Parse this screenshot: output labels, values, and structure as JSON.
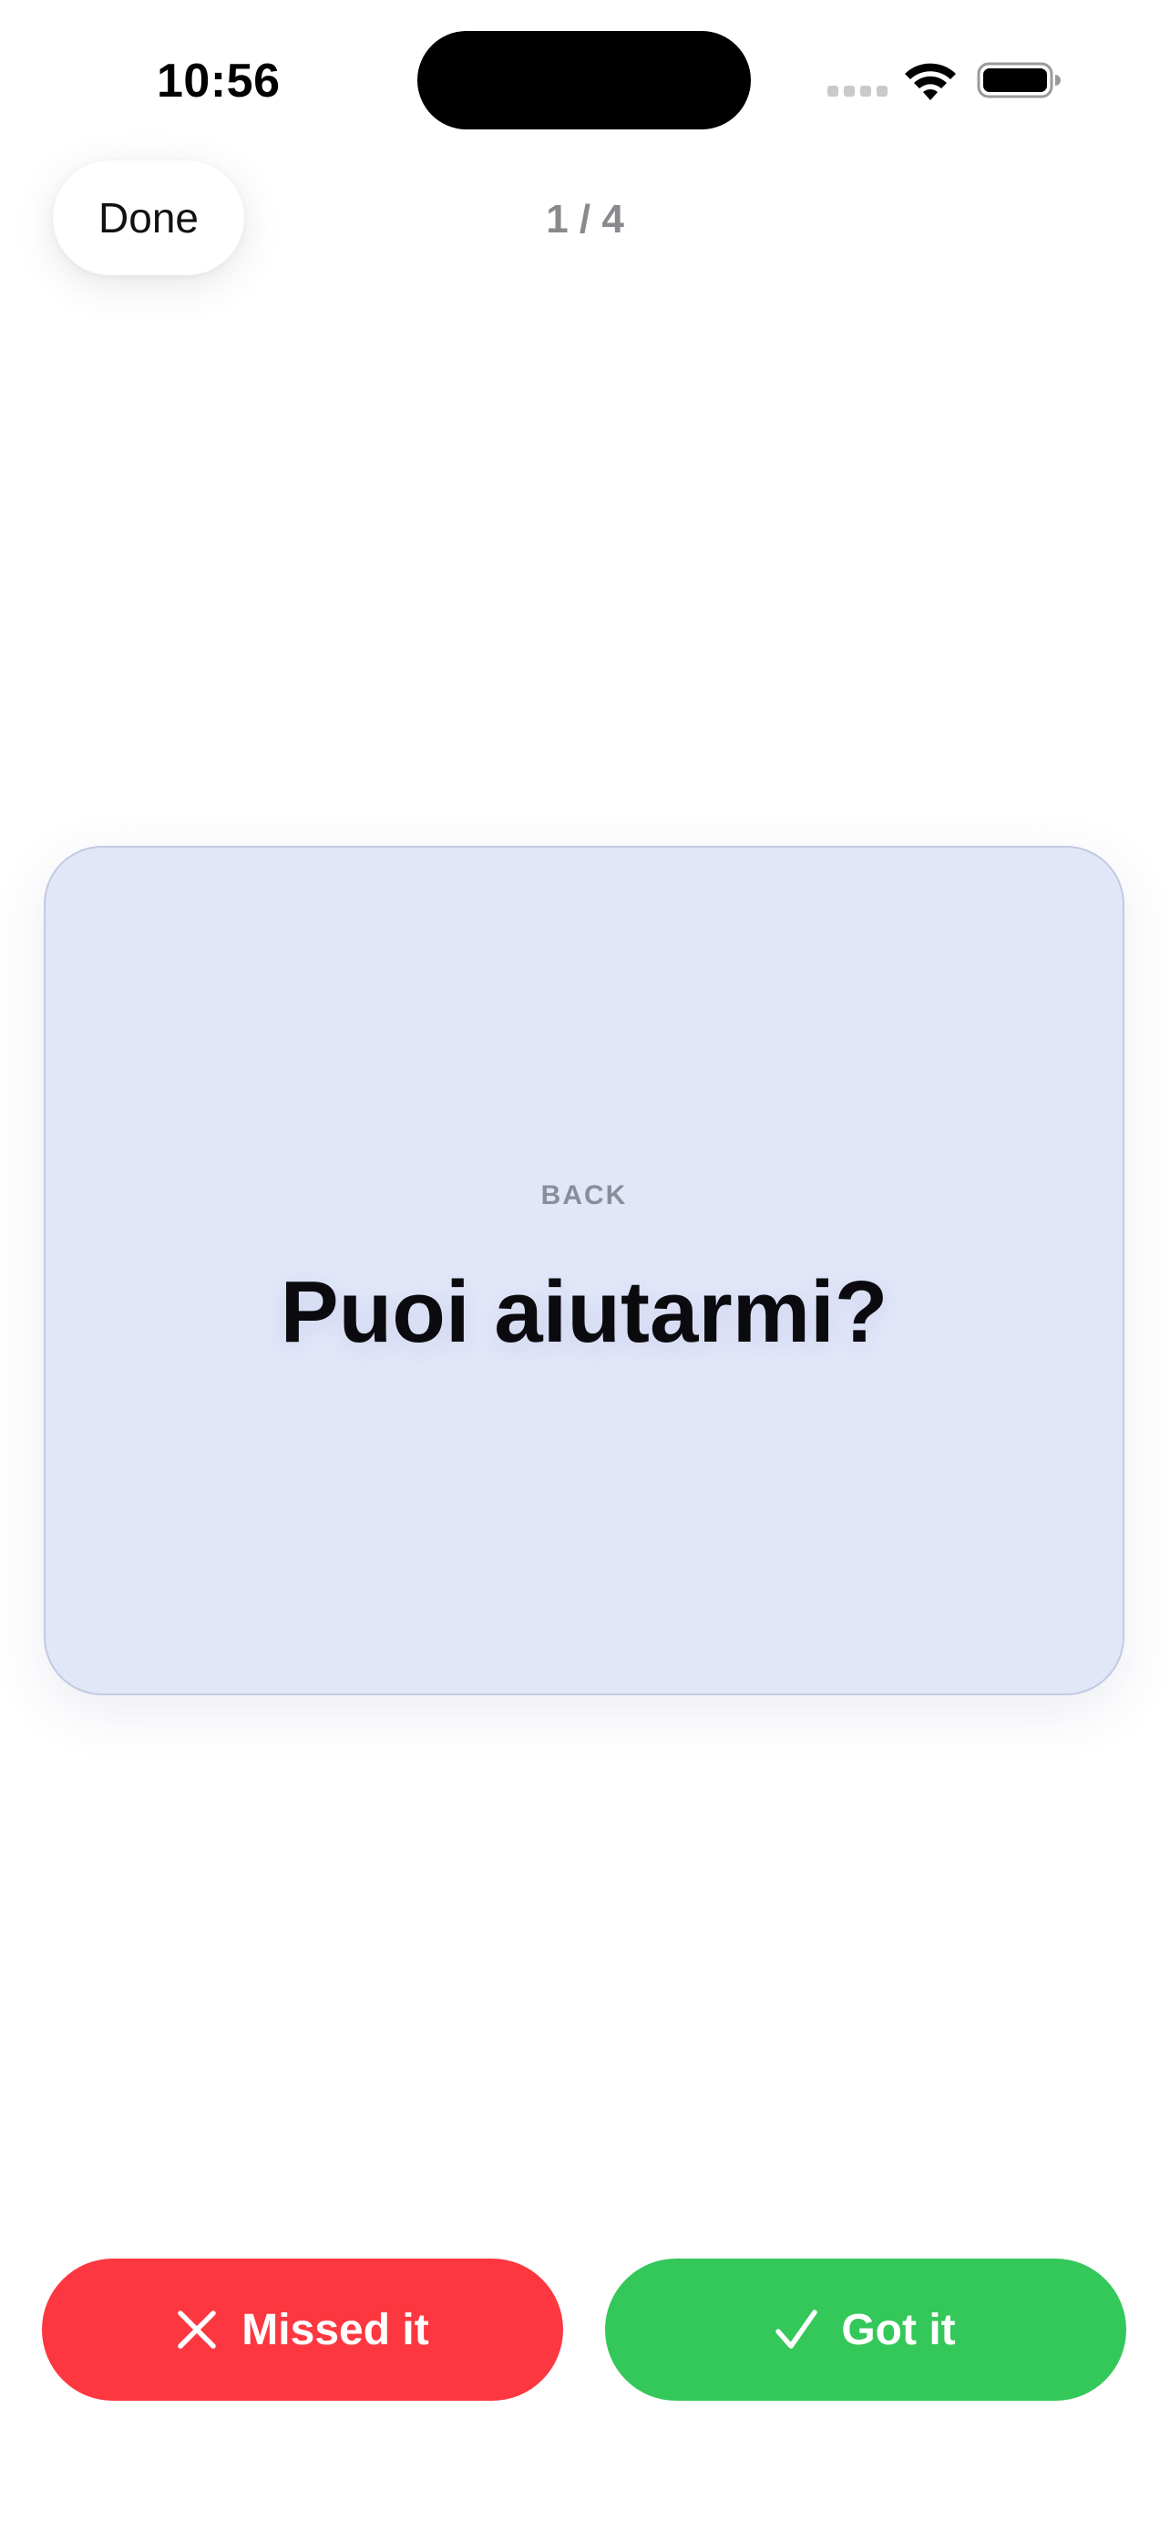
{
  "status_bar": {
    "time": "10:56",
    "icons": [
      "cellular-signal-icon",
      "wifi-icon",
      "battery-icon"
    ]
  },
  "header": {
    "done_label": "Done",
    "progress": "1 / 4"
  },
  "card": {
    "side_label": "BACK",
    "text": "Puoi aiutarmi?",
    "background_color": "#e1e6f9"
  },
  "actions": {
    "missed": {
      "label": "Missed it",
      "icon": "x-mark-icon",
      "color": "#fd3740"
    },
    "got": {
      "label": "Got it",
      "icon": "checkmark-icon",
      "color": "#34c759"
    }
  }
}
